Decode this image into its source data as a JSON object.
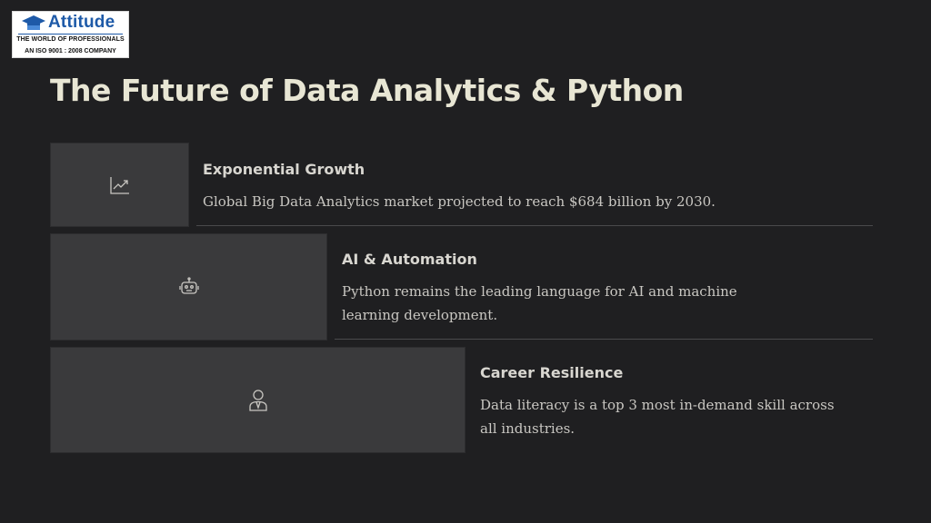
{
  "logo": {
    "name": "Attitude",
    "tagline": "THE WORLD OF PROFESSIONALS",
    "certification": "AN ISO 9001 : 2008 COMPANY"
  },
  "page_title": "The Future of Data Analytics & Python",
  "items": [
    {
      "icon": "trend-chart-icon",
      "title": "Exponential Growth",
      "description": "Global Big Data Analytics market projected to reach $684 billion by 2030."
    },
    {
      "icon": "robot-icon",
      "title": "AI & Automation",
      "description": "Python remains the leading language for AI and machine learning development."
    },
    {
      "icon": "professional-person-icon",
      "title": "Career Resilience",
      "description": "Data literacy is a top 3 most in-demand skill across all industries."
    }
  ],
  "colors": {
    "background": "#1f1f21",
    "card": "#3a3a3c",
    "title": "#e8e6d4",
    "text": "#c9c7c2",
    "brand": "#1e5aa8"
  }
}
